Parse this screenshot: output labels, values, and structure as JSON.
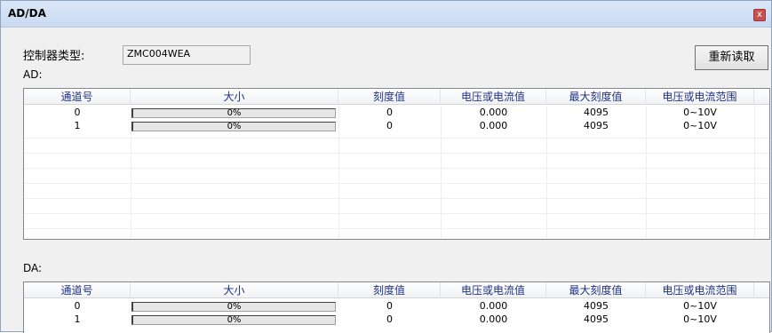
{
  "window": {
    "title": "AD/DA",
    "close_glyph": "x"
  },
  "controller": {
    "label": "控制器类型:",
    "value": "ZMC004WEA"
  },
  "reread_button": "重新读取",
  "ad": {
    "label": "AD:",
    "columns": [
      "通道号",
      "大小",
      "刻度值",
      "电压或电流值",
      "最大刻度值",
      "电压或电流范围"
    ],
    "rows": [
      {
        "channel": "0",
        "size": "0%",
        "size_fraction": 0,
        "scale": "0",
        "value": "0.000",
        "max_scale": "4095",
        "range": "0~10V"
      },
      {
        "channel": "1",
        "size": "0%",
        "size_fraction": 0,
        "scale": "0",
        "value": "0.000",
        "max_scale": "4095",
        "range": "0~10V"
      }
    ]
  },
  "da": {
    "label": "DA:",
    "columns": [
      "通道号",
      "大小",
      "刻度值",
      "电压或电流值",
      "最大刻度值",
      "电压或电流范围"
    ],
    "rows": [
      {
        "channel": "0",
        "size": "0%",
        "size_fraction": 0,
        "scale": "0",
        "value": "0.000",
        "max_scale": "4095",
        "range": "0~10V"
      },
      {
        "channel": "1",
        "size": "0%",
        "size_fraction": 0,
        "scale": "0",
        "value": "0.000",
        "max_scale": "4095",
        "range": "0~10V"
      }
    ]
  }
}
